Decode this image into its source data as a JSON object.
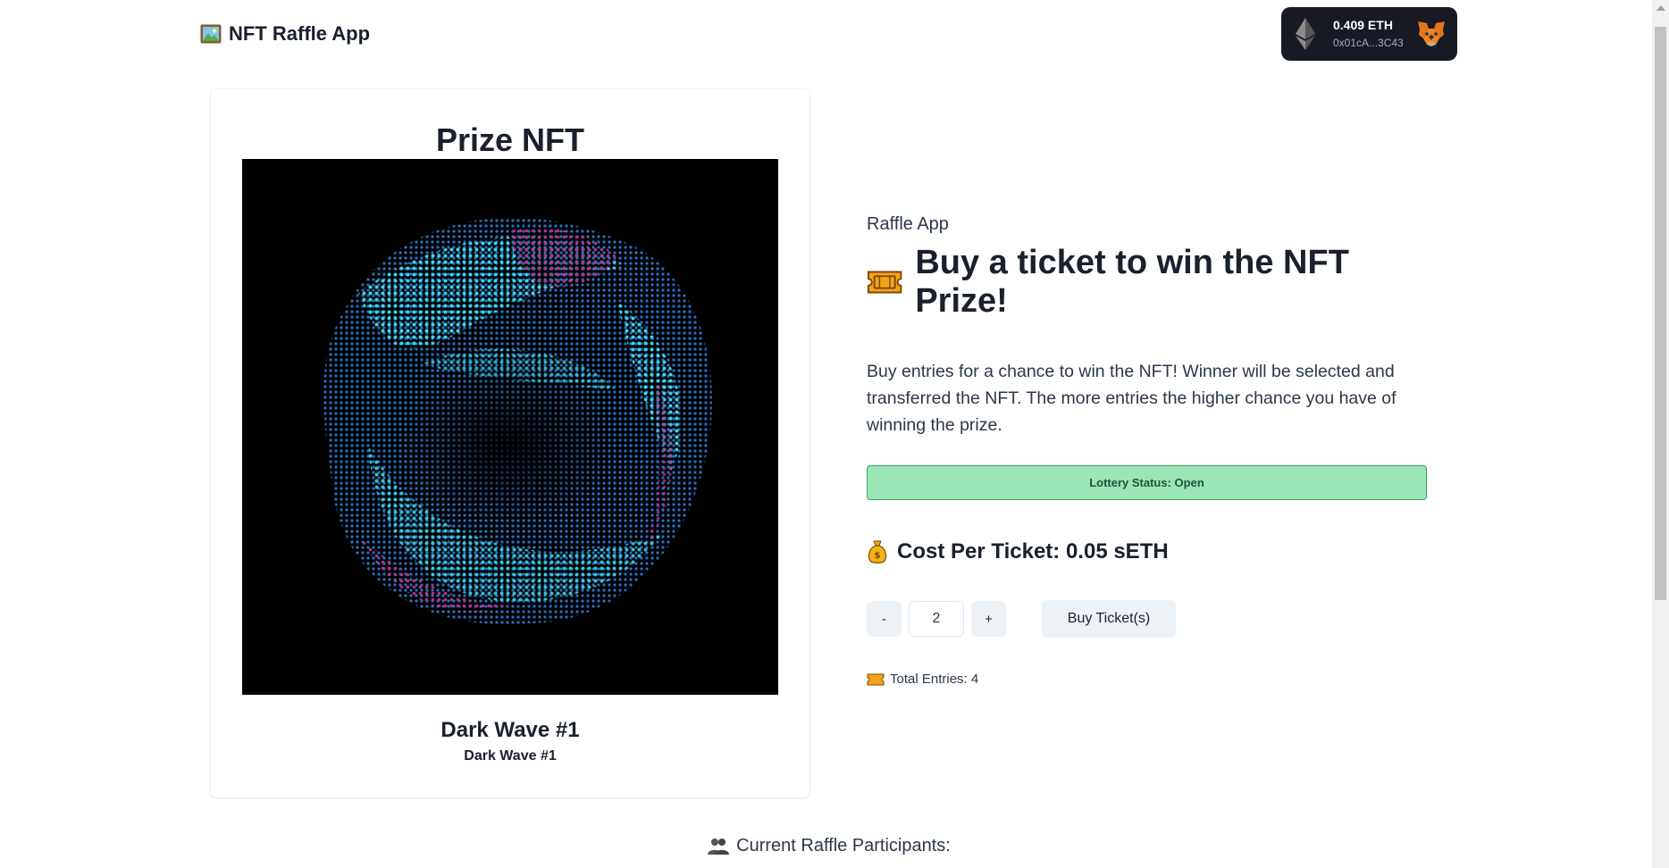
{
  "header": {
    "brand_title": "NFT Raffle App",
    "brand_icon": "framed-picture-icon"
  },
  "wallet": {
    "balance": "0.409 ETH",
    "address": "0x01cA...3C43",
    "network_icon": "ethereum-icon",
    "wallet_icon": "metamask-fox-icon"
  },
  "nft_card": {
    "heading": "Prize NFT",
    "name": "Dark Wave #1",
    "subtitle": "Dark Wave #1"
  },
  "raffle": {
    "eyebrow": "Raffle App",
    "headline": "Buy a ticket to win the NFT Prize!",
    "description": "Buy entries for a chance to win the NFT! Winner will be selected and transferred the NFT. The more entries the higher chance you have of winning the prize.",
    "status": "Lottery Status: Open",
    "cost": "Cost Per Ticket: 0.05 sETH",
    "decrement_label": "-",
    "increment_label": "+",
    "quantity": "2",
    "buy_label": "Buy Ticket(s)",
    "entries": "Total Entries: 4"
  },
  "participants": {
    "label": "Current Raffle Participants:"
  },
  "colors": {
    "status_bg": "#9ae6b4",
    "status_border": "#38a169",
    "wallet_bg": "#171923",
    "button_bg": "#edf2f7"
  }
}
